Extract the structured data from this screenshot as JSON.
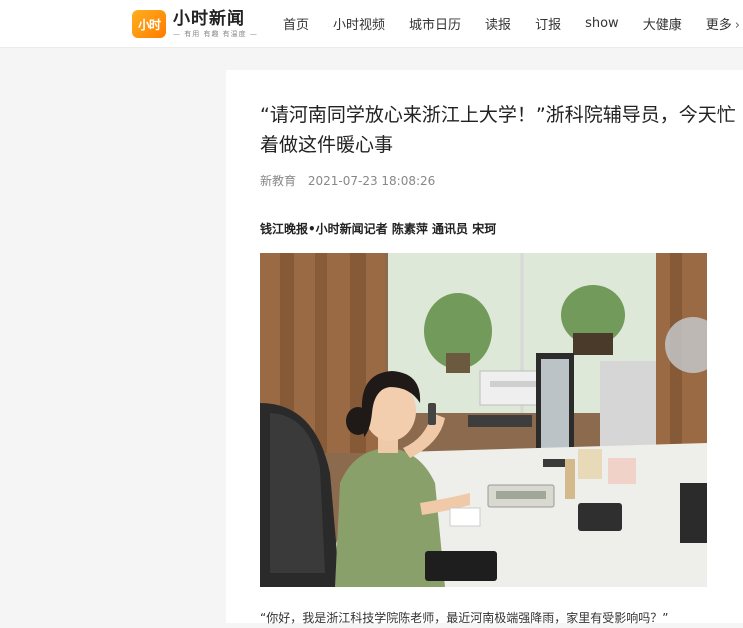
{
  "header": {
    "logo": {
      "mark": "小时",
      "name": "小时新闻",
      "slogan": "— 有用 有趣 有温度 —"
    },
    "nav": [
      "首页",
      "小时视频",
      "城市日历",
      "读报",
      "订报",
      "show",
      "大健康",
      "更多"
    ],
    "more_arrow_icon": "chevron-right-icon"
  },
  "article": {
    "title": "“请河南同学放心来浙江上大学！”浙科院辅导员，今天忙着做这件暖心事",
    "source": "新教育",
    "datetime": "2021-07-23 18:08:26",
    "byline": "钱江晚报•小时新闻记者 陈素萍 通讯员 宋珂",
    "photo": "photo of a woman at an office desk talking on the phone",
    "first_paragraph": "“你好，我是浙江科技学院陈老师，最近河南极端强降雨，家里有受影响吗？”"
  },
  "colors": {
    "logo_orange": "#ff8a00",
    "page_bg": "#f5f5f5",
    "text_primary": "#222222",
    "text_meta": "#888888"
  }
}
